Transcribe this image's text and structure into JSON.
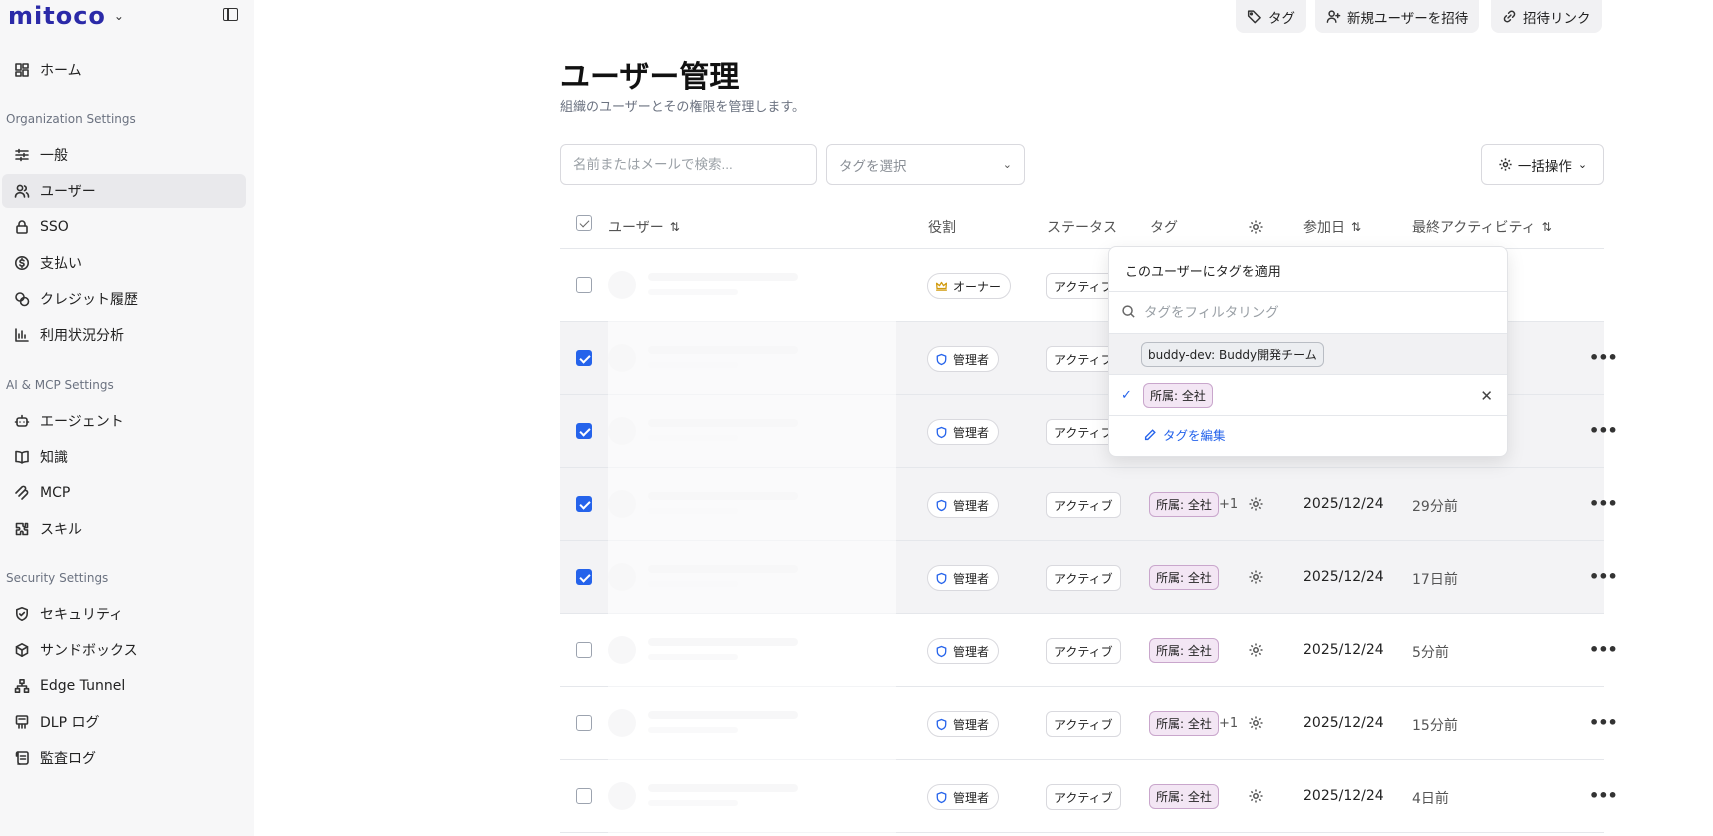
{
  "brand": {
    "name": "mitoco"
  },
  "sidebar": {
    "home": "ホーム",
    "sections": {
      "org": "Organization Settings",
      "ai": "AI & MCP Settings",
      "security": "Security Settings"
    },
    "org_items": [
      "一般",
      "ユーザー",
      "SSO",
      "支払い",
      "クレジット履歴",
      "利用状況分析"
    ],
    "ai_items": [
      "エージェント",
      "知識",
      "MCP",
      "スキル"
    ],
    "security_items": [
      "セキュリティ",
      "サンドボックス",
      "Edge Tunnel",
      "DLP ログ",
      "監査ログ"
    ],
    "active": "ユーザー"
  },
  "topbar": {
    "tag_label": "タグ",
    "invite_user_label": "新規ユーザーを招待",
    "invite_link_label": "招待リンク"
  },
  "header": {
    "title": "ユーザー管理",
    "description": "組織のユーザーとその権限を管理します。"
  },
  "filters": {
    "search_placeholder": "名前またはメールで検索...",
    "tag_select_placeholder": "タグを選択",
    "bulk_label": "一括操作"
  },
  "table": {
    "columns": {
      "user": "ユーザー",
      "role": "役割",
      "status": "ステータス",
      "tags": "タグ",
      "joined": "参加日",
      "last_activity": "最終アクティビティ"
    },
    "rows": [
      {
        "checked": false,
        "role": "オーナー",
        "role_type": "owner",
        "status": "アクティブ",
        "tag": "",
        "extra": "",
        "date": "",
        "activity": ""
      },
      {
        "checked": true,
        "role": "管理者",
        "role_type": "admin",
        "status": "アクティブ",
        "tag": "",
        "extra": "",
        "date": "",
        "activity": ""
      },
      {
        "checked": true,
        "role": "管理者",
        "role_type": "admin",
        "status": "アクティブ",
        "tag": "",
        "extra": "",
        "date": "",
        "activity": ""
      },
      {
        "checked": true,
        "role": "管理者",
        "role_type": "admin",
        "status": "アクティブ",
        "tag": "所属: 全社",
        "extra": "+1",
        "date": "2025/12/24",
        "activity": "29分前"
      },
      {
        "checked": true,
        "role": "管理者",
        "role_type": "admin",
        "status": "アクティブ",
        "tag": "所属: 全社",
        "extra": "",
        "date": "2025/12/24",
        "activity": "17日前"
      },
      {
        "checked": false,
        "role": "管理者",
        "role_type": "admin",
        "status": "アクティブ",
        "tag": "所属: 全社",
        "extra": "",
        "date": "2025/12/24",
        "activity": "5分前"
      },
      {
        "checked": false,
        "role": "管理者",
        "role_type": "admin",
        "status": "アクティブ",
        "tag": "所属: 全社",
        "extra": "+1",
        "date": "2025/12/24",
        "activity": "15分前"
      },
      {
        "checked": false,
        "role": "管理者",
        "role_type": "admin",
        "status": "アクティブ",
        "tag": "所属: 全社",
        "extra": "",
        "date": "2025/12/24",
        "activity": "4日前"
      }
    ]
  },
  "tag_popover": {
    "title": "このユーザーにタグを適用",
    "filter_placeholder": "タグをフィルタリング",
    "options": [
      {
        "label": "buddy-dev: Buddy開発チーム",
        "selected": false
      },
      {
        "label": "所属: 全社",
        "selected": true
      }
    ],
    "edit_label": "タグを編集"
  },
  "colors": {
    "accent": "#2563eb",
    "brand": "#2b2aa8",
    "tag_bg": "#f3e6f4",
    "owner_crown": "#d19a0c"
  }
}
